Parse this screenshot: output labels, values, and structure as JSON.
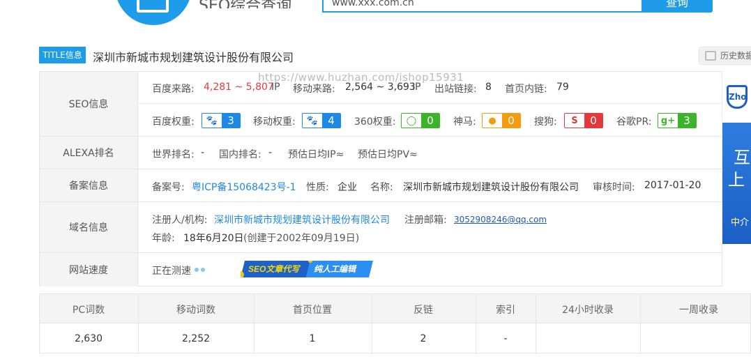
{
  "header": {
    "tool_title": "SEO综合查询",
    "search_value": "www.xxx.com.cn",
    "search_button": "查询"
  },
  "title_row": {
    "badge": "TITLE信息",
    "site_title": "深圳市新城市规划建筑设计股份有限公司",
    "history_button": "历史数据"
  },
  "watermark": "https://www.huzhan.com/ishop15931",
  "seo": {
    "label": "SEO信息",
    "baidu_traffic_label": "百度来路:",
    "baidu_traffic_value": "4,281 ~ 5,807",
    "baidu_traffic_unit": "IP",
    "mobile_traffic_label": "移动来路:",
    "mobile_traffic_value": "2,564 ~ 3,693",
    "mobile_traffic_unit": "IP",
    "outbound_label": "出站链接:",
    "outbound_value": "8",
    "homepage_links_label": "首页内链:",
    "homepage_links_value": "79",
    "weights": [
      {
        "label": "百度权重:",
        "icon": "paw-icon",
        "value": "3",
        "color": "#1e88e5"
      },
      {
        "label": "移动权重:",
        "icon": "paw-icon",
        "value": "4",
        "color": "#1e88e5"
      },
      {
        "label": "360权重:",
        "icon": "360-icon",
        "value": "0",
        "color": "#3db32c"
      },
      {
        "label": "神马:",
        "icon": "shenma-icon",
        "value": "0",
        "color": "#f39c12"
      },
      {
        "label": "搜狗:",
        "icon": "sogou-icon",
        "value": "0",
        "color": "#e4393c"
      },
      {
        "label": "谷歌PR:",
        "icon": "google-plus-icon",
        "value": "3",
        "color": "#3db32c"
      }
    ]
  },
  "alexa": {
    "label": "ALEXA排名",
    "world_rank_label": "世界排名:",
    "world_rank_value": "-",
    "domestic_rank_label": "国内排名:",
    "domestic_rank_value": "-",
    "daily_ip_label": "预估日均IP≈",
    "daily_pv_label": "预估日均PV≈"
  },
  "icp": {
    "label": "备案信息",
    "number_label": "备案号:",
    "number_value": "粤ICP备15068423号-1",
    "nature_label": "性质:",
    "nature_value": "企业",
    "name_label": "名称:",
    "name_value": "深圳市新城市规划建筑设计股份有限公司",
    "review_label": "审核时间:",
    "review_value": "2017-01-20"
  },
  "domain": {
    "label": "域名信息",
    "registrant_label": "注册人/机构:",
    "registrant_value": "深圳市新城市规划建筑设计股份有限公司",
    "email_label": "注册邮箱:",
    "email_value": "3052908246@qq.com",
    "age_label": "年龄:",
    "age_value": "18年6月20日",
    "created_value": "(创建于2002年09月19日)"
  },
  "speed": {
    "label": "网站速度",
    "status": "正在测速",
    "promo_left": "SEO文章代写",
    "promo_right": "纯人工编辑"
  },
  "side_ad": {
    "logo": "Zho",
    "line1": "互",
    "line2": "上",
    "line3": "中介"
  },
  "stats": {
    "headers": [
      "PC词数",
      "移动词数",
      "首页位置",
      "反链",
      "索引",
      "24小时收录",
      "一周收录"
    ],
    "values": [
      "2,630",
      "2,252",
      "1",
      "2",
      "-",
      "",
      ""
    ]
  },
  "colors": {
    "accent": "#1e9be9",
    "red": "#e4393c",
    "link": "#1e88e5"
  }
}
